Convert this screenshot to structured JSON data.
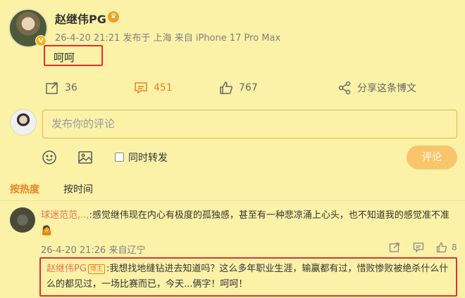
{
  "post": {
    "username": "赵继伟PG",
    "verified_badge": "V",
    "crown_icon": "crown-icon",
    "meta": "26-4-20 21:21 发布于 上海  来自 iPhone 17 Pro Max",
    "text": "呵呵"
  },
  "actions": {
    "share_count": "36",
    "comment_count": "451",
    "like_count": "767",
    "share_post_label": "分享这条博文"
  },
  "composer": {
    "placeholder": "发布你的评论",
    "repost_label": "同时转发",
    "submit_label": "评论"
  },
  "sort": {
    "hot_label": "按热度",
    "time_label": "按时间"
  },
  "comment": {
    "username": "球迷范范,..,",
    "text": ":感觉继伟现在内心有极度的孤独感，甚至有一种悲凉涌上心头，也不知道我的感觉准不准",
    "emoji": "🤷",
    "meta": "26-4-20 21:26 来自辽宁",
    "like_count": "8"
  },
  "reply": {
    "username": "赵继伟PG",
    "author_tag": "博主",
    "text": ":我想找地缝钻进去知道吗？这么多年职业生涯，输赢都有过，惜败惨败被绝杀什么什么的都见过，一场比赛而已，今天...俩字！呵呵！"
  },
  "colors": {
    "background": "#fbf2a8",
    "accent": "#f08020",
    "highlight_border": "#e03030",
    "link_name": "#eb7350"
  }
}
